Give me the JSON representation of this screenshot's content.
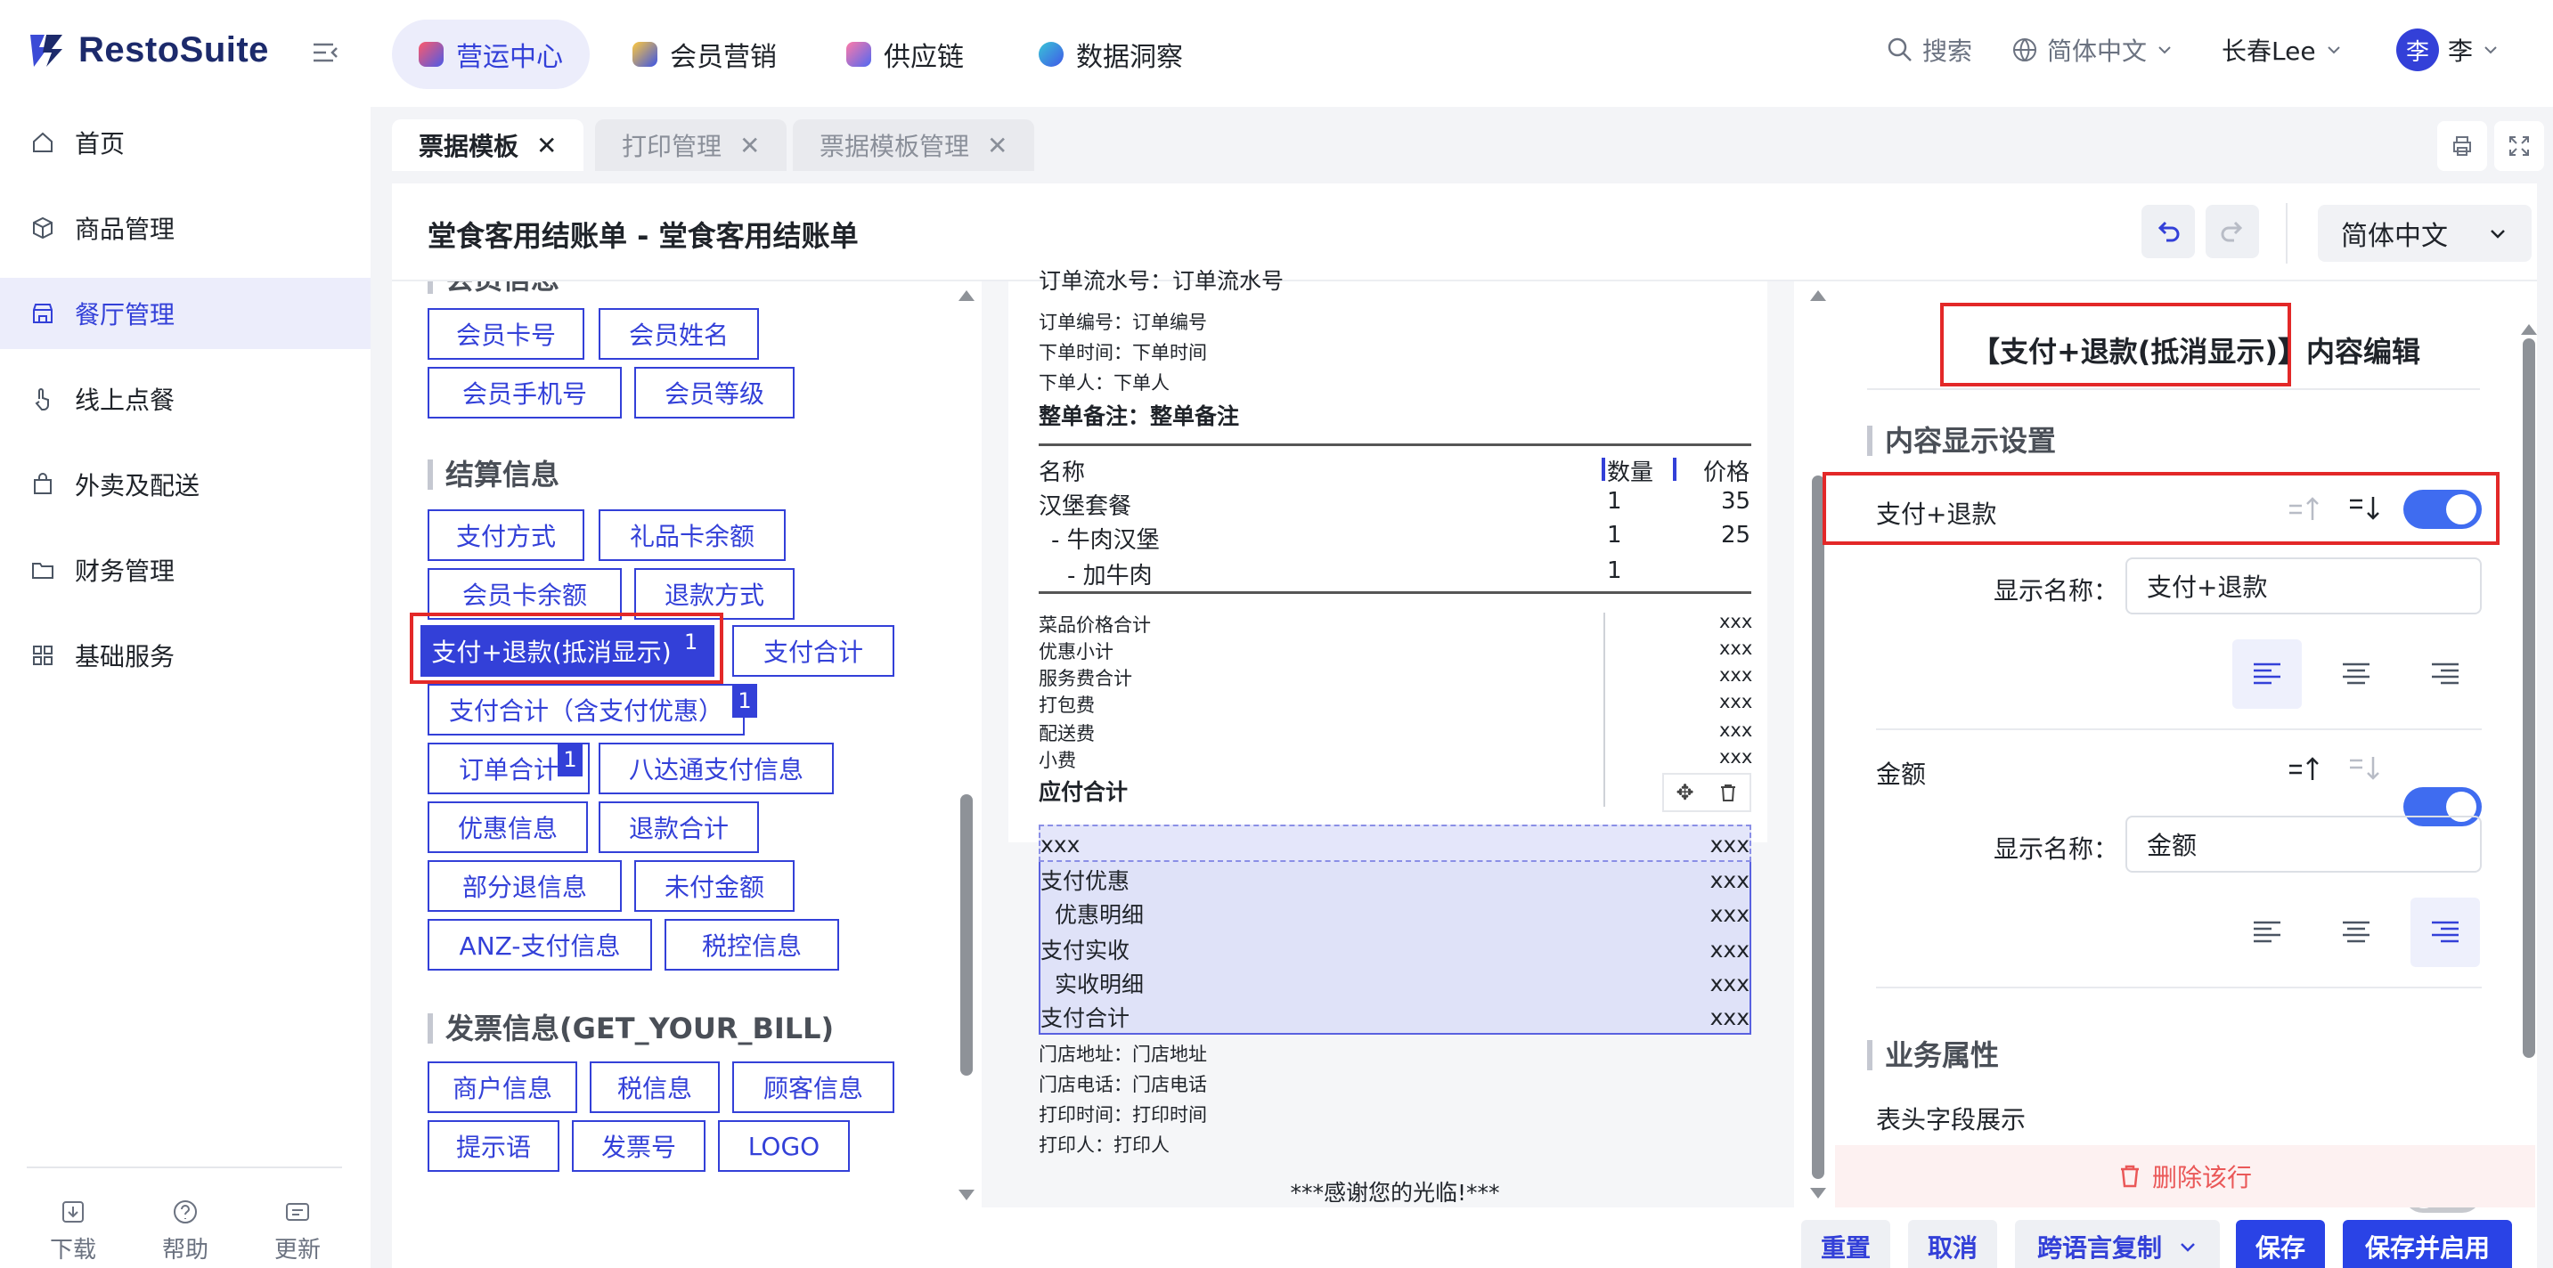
{
  "app": {
    "name": "RestoSuite"
  },
  "top_nav": [
    {
      "label": "营运中心"
    },
    {
      "label": "会员营销"
    },
    {
      "label": "供应链"
    },
    {
      "label": "数据洞察"
    }
  ],
  "top_right": {
    "search": "搜索",
    "language": "简体中文",
    "store": "长春Lee",
    "avatar_char": "李",
    "user": "李"
  },
  "sidebar": {
    "items": [
      {
        "label": "首页"
      },
      {
        "label": "商品管理"
      },
      {
        "label": "餐厅管理"
      },
      {
        "label": "线上点餐"
      },
      {
        "label": "外卖及配送"
      },
      {
        "label": "财务管理"
      },
      {
        "label": "基础服务"
      }
    ],
    "bottom": [
      {
        "label": "下载"
      },
      {
        "label": "帮助"
      },
      {
        "label": "更新"
      }
    ]
  },
  "page_tabs": [
    {
      "label": "票据模板"
    },
    {
      "label": "打印管理"
    },
    {
      "label": "票据模板管理"
    }
  ],
  "header": {
    "title": "堂食客用结账单 - 堂食客用结账单",
    "language": "简体中文"
  },
  "palette": {
    "member_section": "会员信息",
    "member": [
      "会员卡号",
      "会员姓名",
      "会员手机号",
      "会员等级"
    ],
    "settle_section": "结算信息",
    "settle": [
      "支付方式",
      "礼品卡余额",
      "会员卡余额",
      "退款方式",
      "支付+退款(抵消显示)",
      "支付合计",
      "支付合计（含支付优惠）",
      "订单合计",
      "八达通支付信息",
      "优惠信息",
      "退款合计",
      "部分退信息",
      "未付金额",
      "ANZ-支付信息",
      "税控信息"
    ],
    "badge": "1",
    "invoice_section": "发票信息(GET_YOUR_BILL)",
    "invoice": [
      "商户信息",
      "税信息",
      "顾客信息",
      "提示语",
      "发票号",
      "LOGO"
    ]
  },
  "receipt": {
    "top_lines": [
      "订单流水号：订单流水号",
      "订单编号：订单编号",
      "下单时间：下单时间",
      "下单人：下单人"
    ],
    "remark": "整单备注：整单备注",
    "cols": {
      "name": "名称",
      "qty": "数量",
      "price": "价格"
    },
    "items": [
      {
        "name": "汉堡套餐",
        "qty": "1",
        "price": "35"
      },
      {
        "name": "- 牛肉汉堡",
        "qty": "1",
        "price": "25"
      },
      {
        "name": "- 加牛肉",
        "qty": "1",
        "price": ""
      }
    ],
    "summary": [
      "菜品价格合计",
      "优惠小计",
      "服务费合计",
      "打包费",
      "配送费",
      "小费"
    ],
    "summary_value": "xxx",
    "due": "应付合计",
    "pay_rows": [
      {
        "label": "xxx",
        "value": "xxx"
      },
      {
        "label": "支付优惠",
        "value": "xxx"
      },
      {
        "label": "优惠明细",
        "value": "xxx"
      },
      {
        "label": "支付实收",
        "value": "xxx"
      },
      {
        "label": "实收明细",
        "value": "xxx"
      },
      {
        "label": "支付合计",
        "value": "xxx"
      }
    ],
    "bottom_lines": [
      "门店地址：门店地址",
      "门店电话：门店电话",
      "打印时间：打印时间",
      "打印人：打印人"
    ],
    "thanks": "***感谢您的光临!***"
  },
  "editor": {
    "title": "【支付+退款(抵消显示)】内容编辑",
    "display_section": "内容显示设置",
    "field1": {
      "label": "支付+退款",
      "name_label": "显示名称：",
      "name_value": "支付+退款"
    },
    "field2": {
      "label": "金额",
      "name_label": "显示名称：",
      "name_value": "金额"
    },
    "biz_section": "业务属性",
    "header_field": "表头字段展示",
    "delete": "删除该行"
  },
  "footer": {
    "reset": "重置",
    "cancel": "取消",
    "copy": "跨语言复制",
    "save": "保存",
    "save_enable": "保存并启用"
  },
  "colors": {
    "primary": "#3340d8",
    "toggle": "#3f6cf0",
    "danger": "#e32828"
  }
}
